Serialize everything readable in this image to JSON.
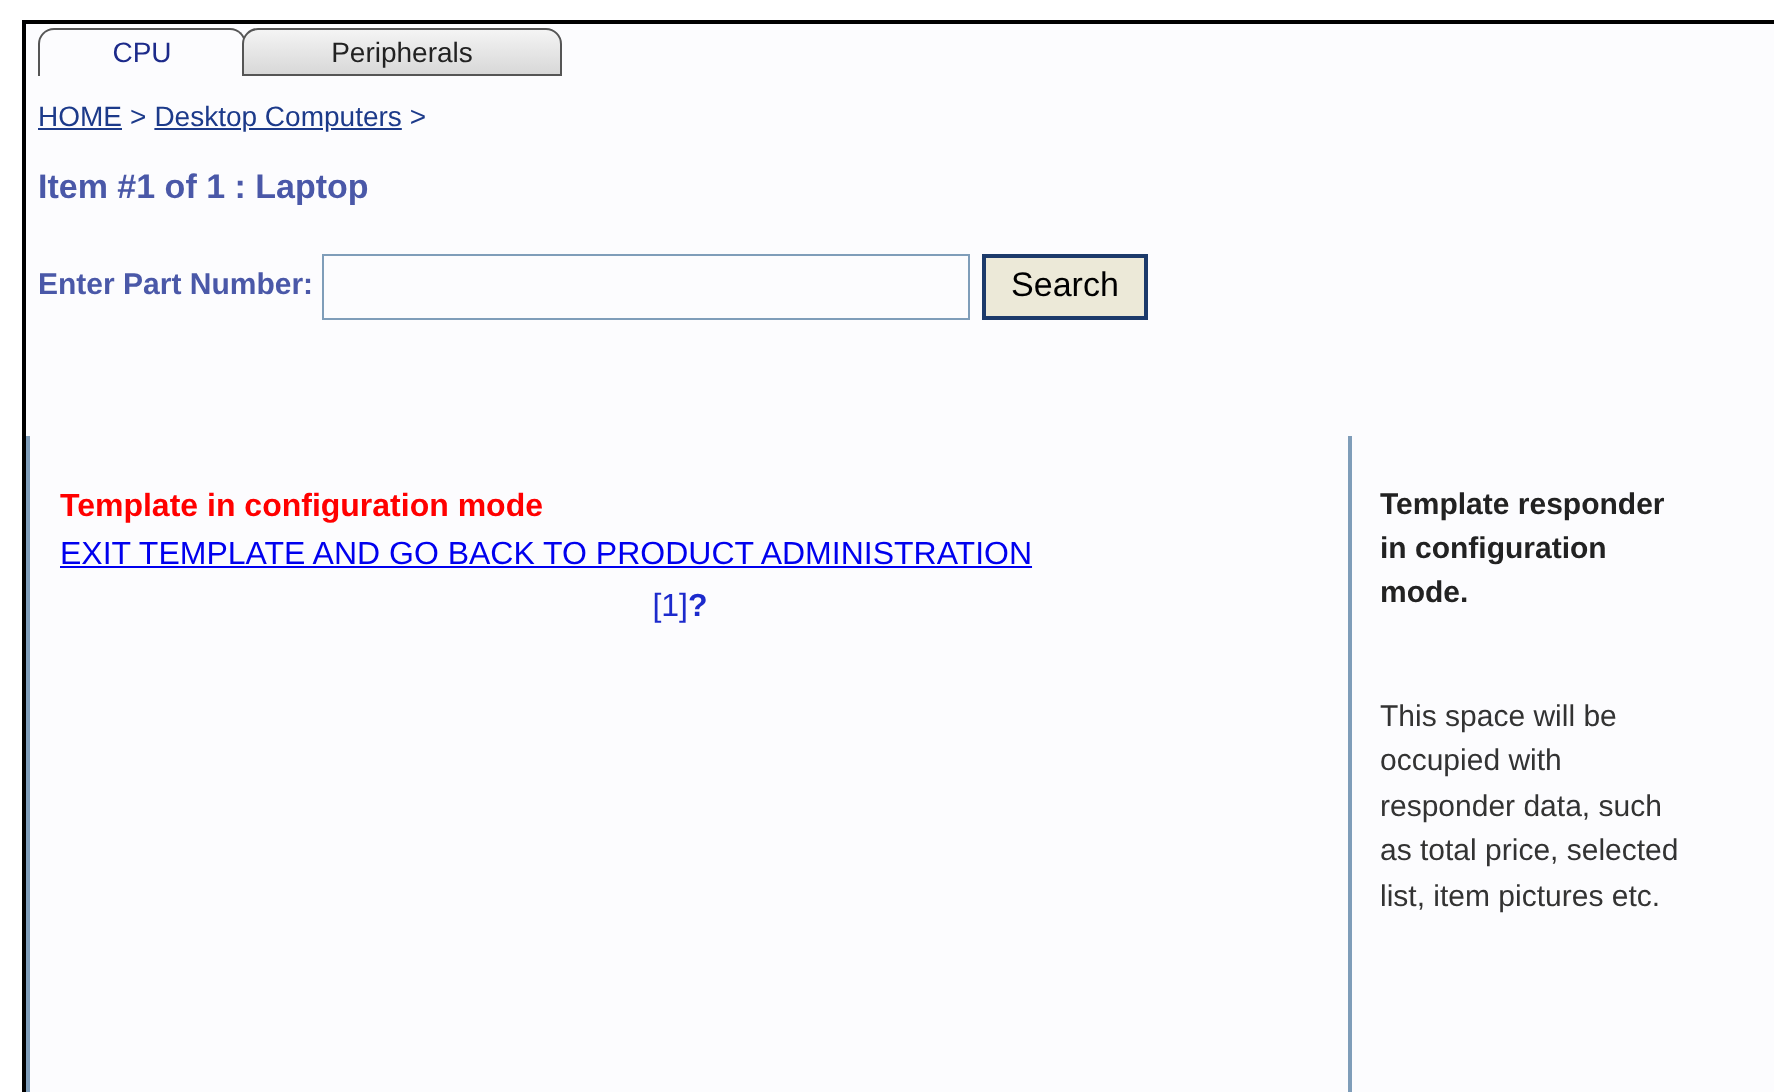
{
  "tabs": [
    {
      "label": "CPU",
      "selected": true
    },
    {
      "label": "Peripherals",
      "selected": false
    }
  ],
  "breadcrumb": [
    {
      "label": "HOME",
      "separator": ">"
    },
    {
      "label": "Desktop Computers",
      "separator": ">"
    }
  ],
  "heading": "Item #1 of 1 : Laptop",
  "search": {
    "label": "Enter Part Number:",
    "button": "Search"
  },
  "main": {
    "status": "Template in configuration mode",
    "exit_link": "EXIT TEMPLATE AND GO BACK TO PRODUCT ADMINISTRATION",
    "page_link": "[1]",
    "help": "?"
  },
  "responder": {
    "title": "Template responder in configuration mode.",
    "body": "This space will be occupied with responder data, such as total price, selected list, item pictures etc."
  }
}
